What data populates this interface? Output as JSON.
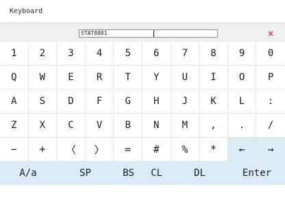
{
  "window": {
    "title": "Keyboard"
  },
  "input": {
    "value": "STAT8001"
  },
  "close_label": "×",
  "rows": [
    [
      {
        "label": "1",
        "blue": false
      },
      {
        "label": "2",
        "blue": false
      },
      {
        "label": "3",
        "blue": false
      },
      {
        "label": "4",
        "blue": false
      },
      {
        "label": "5",
        "blue": false
      },
      {
        "label": "6",
        "blue": false
      },
      {
        "label": "7",
        "blue": false
      },
      {
        "label": "8",
        "blue": false
      },
      {
        "label": "9",
        "blue": false
      },
      {
        "label": "0",
        "blue": false
      }
    ],
    [
      {
        "label": "Q",
        "blue": false
      },
      {
        "label": "W",
        "blue": false
      },
      {
        "label": "E",
        "blue": false
      },
      {
        "label": "R",
        "blue": false
      },
      {
        "label": "T",
        "blue": false
      },
      {
        "label": "Y",
        "blue": false
      },
      {
        "label": "U",
        "blue": false
      },
      {
        "label": "I",
        "blue": false
      },
      {
        "label": "O",
        "blue": false
      },
      {
        "label": "P",
        "blue": false
      }
    ],
    [
      {
        "label": "A",
        "blue": false
      },
      {
        "label": "S",
        "blue": false
      },
      {
        "label": "D",
        "blue": false
      },
      {
        "label": "F",
        "blue": false
      },
      {
        "label": "G",
        "blue": false
      },
      {
        "label": "H",
        "blue": false
      },
      {
        "label": "J",
        "blue": false
      },
      {
        "label": "K",
        "blue": false
      },
      {
        "label": "L",
        "blue": false
      },
      {
        "label": ":",
        "blue": false
      }
    ],
    [
      {
        "label": "Z",
        "blue": false
      },
      {
        "label": "X",
        "blue": false
      },
      {
        "label": "C",
        "blue": false
      },
      {
        "label": "V",
        "blue": false
      },
      {
        "label": "B",
        "blue": false
      },
      {
        "label": "N",
        "blue": false
      },
      {
        "label": "M",
        "blue": false
      },
      {
        "label": ",",
        "blue": false
      },
      {
        "label": ".",
        "blue": false
      },
      {
        "label": "/",
        "blue": false
      }
    ],
    [
      {
        "label": "−",
        "blue": false
      },
      {
        "label": "+",
        "blue": false
      },
      {
        "label": "〈",
        "blue": false
      },
      {
        "label": "〉",
        "blue": false
      },
      {
        "label": "=",
        "blue": false
      },
      {
        "label": "#",
        "blue": false
      },
      {
        "label": "%",
        "blue": false
      },
      {
        "label": "*",
        "blue": false
      },
      {
        "label": "←",
        "blue": true
      },
      {
        "label": "→",
        "blue": true
      }
    ]
  ],
  "bottom": {
    "case_label": "A/a",
    "space_label": "SP",
    "backspace_label": "BS",
    "clear_label": "CL",
    "delete_label": "DL",
    "enter_label": "Enter"
  },
  "colors": {
    "accent": "#d9ecf8",
    "close": "#e0303a",
    "input_bar": "#f0f0f0"
  }
}
